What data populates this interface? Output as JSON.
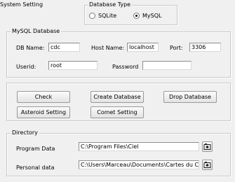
{
  "title": "System Setting",
  "database_type": {
    "legend": "Database Type",
    "options": [
      {
        "label": "SQLite",
        "selected": false
      },
      {
        "label": "MySQL",
        "selected": true
      }
    ]
  },
  "mysql": {
    "legend": "MySQL Database",
    "db_name_label": "DB Name:",
    "db_name_value": "cdc",
    "host_name_label": "Host Name:",
    "host_name_value": "localhost",
    "port_label": "Port:",
    "port_value": "3306",
    "userid_label": "Userid:",
    "userid_value": "root",
    "password_label": "Password",
    "password_value": ""
  },
  "actions": {
    "check": "Check",
    "create_database": "Create Database",
    "drop_database": "Drop Database",
    "asteroid_setting": "Asteroid Setting",
    "comet_setting": "Comet Setting"
  },
  "directory": {
    "legend": "Directory",
    "program_data_label": "Program Data",
    "program_data_value": "C:\\Program Files\\Ciel",
    "personal_data_label": "Personal data",
    "personal_data_value": "C:\\Users\\Marceau\\Documents\\Cartes du Ciel"
  },
  "icons": {
    "browse": "folder-browse-icon"
  }
}
